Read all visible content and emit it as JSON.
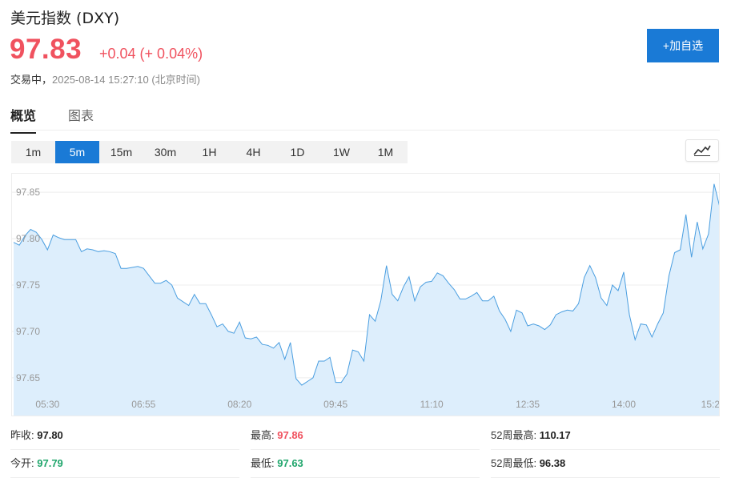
{
  "header": {
    "title": "美元指数 (DXY)",
    "price": "97.83",
    "change": "+0.04 (+ 0.04%)",
    "status_lead": "交易中，",
    "status_time": "2025-08-14 15:27:10 (北京时间)",
    "add_watch_label": "+加自选"
  },
  "tabs": [
    {
      "label": "概览",
      "active": true
    },
    {
      "label": "图表",
      "active": false
    }
  ],
  "periods": [
    {
      "label": "1m"
    },
    {
      "label": "5m",
      "active": true
    },
    {
      "label": "15m"
    },
    {
      "label": "30m"
    },
    {
      "label": "1H"
    },
    {
      "label": "4H"
    },
    {
      "label": "1D"
    },
    {
      "label": "1W"
    },
    {
      "label": "1M"
    }
  ],
  "chart_type_icon": "line-chart-icon",
  "colors": {
    "up": "#f0525f",
    "down": "#20a66c",
    "accent": "#1a7ad6",
    "line": "#4a9ee0",
    "fill": "#ddeefc"
  },
  "chart_data": {
    "type": "area",
    "title": "",
    "xlabel": "",
    "ylabel": "",
    "ylim": [
      97.63,
      97.87
    ],
    "yticks": [
      "97.85",
      "97.80",
      "97.75",
      "97.70",
      "97.65"
    ],
    "ytick_values": [
      97.85,
      97.8,
      97.75,
      97.7,
      97.65
    ],
    "xticks": [
      "05:30",
      "06:55",
      "08:20",
      "09:45",
      "11:10",
      "12:35",
      "14:00",
      "15:2"
    ],
    "xtick_index": [
      6,
      23,
      40,
      57,
      74,
      91,
      108,
      124
    ],
    "grid": true,
    "values": [
      97.796,
      97.793,
      97.803,
      97.81,
      97.807,
      97.799,
      97.788,
      97.804,
      97.801,
      97.799,
      97.799,
      97.799,
      97.786,
      97.789,
      97.788,
      97.786,
      97.787,
      97.786,
      97.784,
      97.768,
      97.768,
      97.769,
      97.77,
      97.768,
      97.76,
      97.752,
      97.752,
      97.755,
      97.75,
      97.736,
      97.732,
      97.728,
      97.74,
      97.73,
      97.73,
      97.718,
      97.705,
      97.708,
      97.7,
      97.698,
      97.71,
      97.693,
      97.692,
      97.694,
      97.686,
      97.685,
      97.682,
      97.688,
      97.67,
      97.688,
      97.649,
      97.642,
      97.646,
      97.65,
      97.668,
      97.668,
      97.672,
      97.645,
      97.645,
      97.654,
      97.68,
      97.678,
      97.668,
      97.718,
      97.711,
      97.733,
      97.771,
      97.74,
      97.733,
      97.748,
      97.759,
      97.733,
      97.748,
      97.753,
      97.754,
      97.763,
      97.76,
      97.752,
      97.745,
      97.735,
      97.735,
      97.738,
      97.742,
      97.733,
      97.733,
      97.738,
      97.722,
      97.713,
      97.7,
      97.723,
      97.72,
      97.706,
      97.708,
      97.706,
      97.702,
      97.707,
      97.718,
      97.721,
      97.723,
      97.722,
      97.73,
      97.758,
      97.771,
      97.758,
      97.736,
      97.728,
      97.75,
      97.744,
      97.764,
      97.718,
      97.691,
      97.708,
      97.707,
      97.694,
      97.708,
      97.72,
      97.76,
      97.785,
      97.788,
      97.826,
      97.78,
      97.818,
      97.789,
      97.805,
      97.859,
      97.834
    ]
  },
  "stats": {
    "prev_close_label": "昨收:",
    "prev_close": "97.80",
    "open_label": "今开:",
    "open": "97.79",
    "high_label": "最高:",
    "high": "97.86",
    "low_label": "最低:",
    "low": "97.63",
    "w52_high_label": "52周最高:",
    "w52_high": "110.17",
    "w52_low_label": "52周最低:",
    "w52_low": "96.38"
  }
}
